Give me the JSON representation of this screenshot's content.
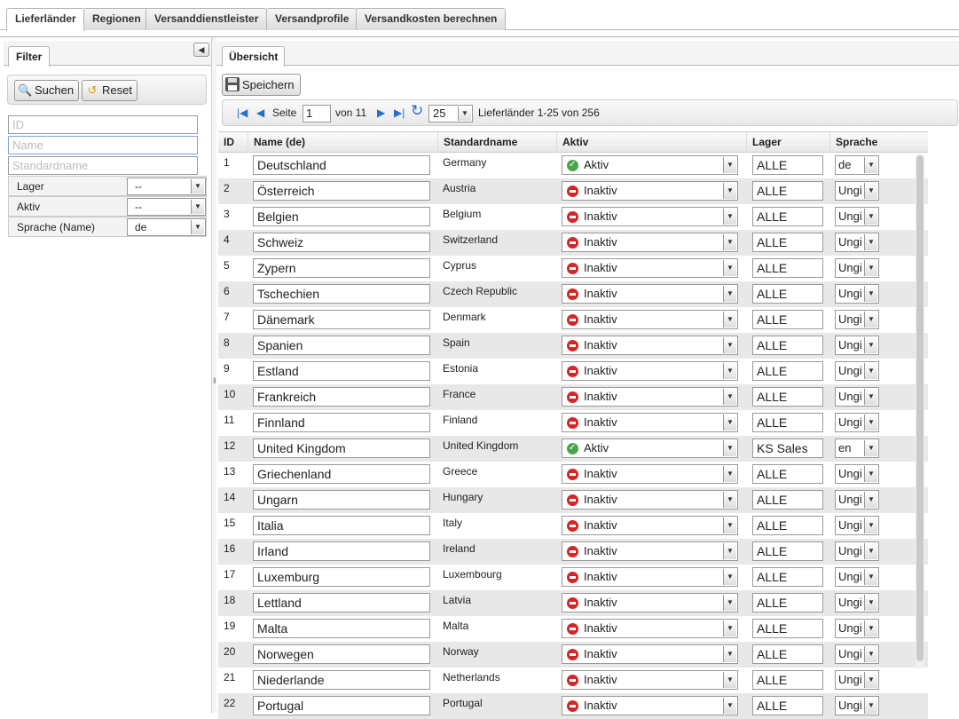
{
  "tabs": [
    "Lieferländer",
    "Regionen",
    "Versanddienstleister",
    "Versandprofile",
    "Versandkosten berechnen"
  ],
  "filter": {
    "tab_label": "Filter",
    "search_label": "Suchen",
    "reset_label": "Reset",
    "id_placeholder": "ID",
    "name_placeholder": "Name",
    "std_placeholder": "Standardname",
    "lager_label": "Lager",
    "lager_value": "--",
    "aktiv_label": "Aktiv",
    "aktiv_value": "--",
    "sprache_label": "Sprache (Name)",
    "sprache_value": "de"
  },
  "overview": {
    "tab_label": "Übersicht",
    "save_label": "Speichern"
  },
  "pager": {
    "page_label": "Seite",
    "page_value": "1",
    "of_label": "von 11",
    "per_page": "25",
    "summary": "Lieferländer 1-25 von 256"
  },
  "grid": {
    "columns": [
      "ID",
      "Name (de)",
      "Standardname",
      "Aktiv",
      "Lager",
      "Sprache"
    ],
    "rows": [
      {
        "id": "1",
        "name": "Deutschland",
        "std": "Germany",
        "aktiv": "Aktiv",
        "lager": "ALLE",
        "lang": "de"
      },
      {
        "id": "2",
        "name": "Österreich",
        "std": "Austria",
        "aktiv": "Inaktiv",
        "lager": "ALLE",
        "lang": "Ungi"
      },
      {
        "id": "3",
        "name": "Belgien",
        "std": "Belgium",
        "aktiv": "Inaktiv",
        "lager": "ALLE",
        "lang": "Ungi"
      },
      {
        "id": "4",
        "name": "Schweiz",
        "std": "Switzerland",
        "aktiv": "Inaktiv",
        "lager": "ALLE",
        "lang": "Ungi"
      },
      {
        "id": "5",
        "name": "Zypern",
        "std": "Cyprus",
        "aktiv": "Inaktiv",
        "lager": "ALLE",
        "lang": "Ungi"
      },
      {
        "id": "6",
        "name": "Tschechien",
        "std": "Czech Republic",
        "aktiv": "Inaktiv",
        "lager": "ALLE",
        "lang": "Ungi"
      },
      {
        "id": "7",
        "name": "Dänemark",
        "std": "Denmark",
        "aktiv": "Inaktiv",
        "lager": "ALLE",
        "lang": "Ungi"
      },
      {
        "id": "8",
        "name": "Spanien",
        "std": "Spain",
        "aktiv": "Inaktiv",
        "lager": "ALLE",
        "lang": "Ungi"
      },
      {
        "id": "9",
        "name": "Estland",
        "std": "Estonia",
        "aktiv": "Inaktiv",
        "lager": "ALLE",
        "lang": "Ungi"
      },
      {
        "id": "10",
        "name": "Frankreich",
        "std": "France",
        "aktiv": "Inaktiv",
        "lager": "ALLE",
        "lang": "Ungi"
      },
      {
        "id": "11",
        "name": "Finnland",
        "std": "Finland",
        "aktiv": "Inaktiv",
        "lager": "ALLE",
        "lang": "Ungi"
      },
      {
        "id": "12",
        "name": "United Kingdom",
        "std": "United Kingdom",
        "aktiv": "Aktiv",
        "lager": "KS Sales",
        "lang": "en"
      },
      {
        "id": "13",
        "name": "Griechenland",
        "std": "Greece",
        "aktiv": "Inaktiv",
        "lager": "ALLE",
        "lang": "Ungi"
      },
      {
        "id": "14",
        "name": "Ungarn",
        "std": "Hungary",
        "aktiv": "Inaktiv",
        "lager": "ALLE",
        "lang": "Ungi"
      },
      {
        "id": "15",
        "name": "Italia",
        "std": "Italy",
        "aktiv": "Inaktiv",
        "lager": "ALLE",
        "lang": "Ungi"
      },
      {
        "id": "16",
        "name": "Irland",
        "std": "Ireland",
        "aktiv": "Inaktiv",
        "lager": "ALLE",
        "lang": "Ungi"
      },
      {
        "id": "17",
        "name": "Luxemburg",
        "std": "Luxembourg",
        "aktiv": "Inaktiv",
        "lager": "ALLE",
        "lang": "Ungi"
      },
      {
        "id": "18",
        "name": "Lettland",
        "std": "Latvia",
        "aktiv": "Inaktiv",
        "lager": "ALLE",
        "lang": "Ungi"
      },
      {
        "id": "19",
        "name": "Malta",
        "std": "Malta",
        "aktiv": "Inaktiv",
        "lager": "ALLE",
        "lang": "Ungi"
      },
      {
        "id": "20",
        "name": "Norwegen",
        "std": "Norway",
        "aktiv": "Inaktiv",
        "lager": "ALLE",
        "lang": "Ungi"
      },
      {
        "id": "21",
        "name": "Niederlande",
        "std": "Netherlands",
        "aktiv": "Inaktiv",
        "lager": "ALLE",
        "lang": "Ungi"
      },
      {
        "id": "22",
        "name": "Portugal",
        "std": "Portugal",
        "aktiv": "Inaktiv",
        "lager": "ALLE",
        "lang": "Ungi"
      }
    ]
  },
  "colors": {
    "active_green": "#4aa64a",
    "inactive_red": "#d42626",
    "pager_blue": "#2a6fc4",
    "row_alt": "#e8e8e8"
  }
}
